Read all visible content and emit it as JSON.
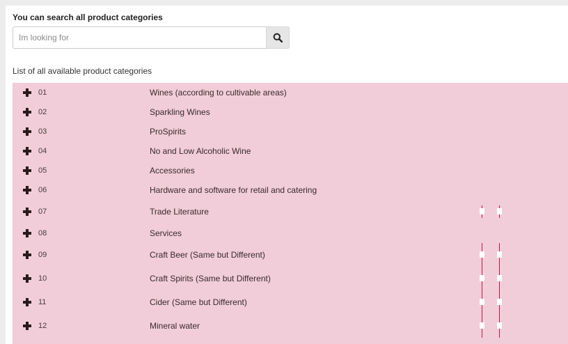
{
  "heading": "You can search all product categories",
  "search": {
    "placeholder": "Im looking for",
    "value": ""
  },
  "list_label": "List of all available product categories",
  "categories": [
    {
      "code": "01",
      "name": "Wines (according to cultivable areas)"
    },
    {
      "code": "02",
      "name": "Sparkling Wines"
    },
    {
      "code": "03",
      "name": "ProSpirits"
    },
    {
      "code": "04",
      "name": "No and Low Alcoholic Wine"
    },
    {
      "code": "05",
      "name": "Accessories"
    },
    {
      "code": "06",
      "name": "Hardware and software for retail and catering"
    },
    {
      "code": "07",
      "name": "Trade Literature"
    },
    {
      "code": "08",
      "name": "Services"
    },
    {
      "code": "09",
      "name": "Craft Beer (Same but Different)"
    },
    {
      "code": "10",
      "name": "Craft Spirits (Same but Different)"
    },
    {
      "code": "11",
      "name": "Cider (Same but Different)"
    },
    {
      "code": "12",
      "name": "Mineral water"
    }
  ],
  "colors": {
    "list_bg": "#f0cdd8",
    "accent_line": "#c0184a"
  },
  "icons": {
    "search": "search-icon",
    "expand": "plus-icon"
  }
}
